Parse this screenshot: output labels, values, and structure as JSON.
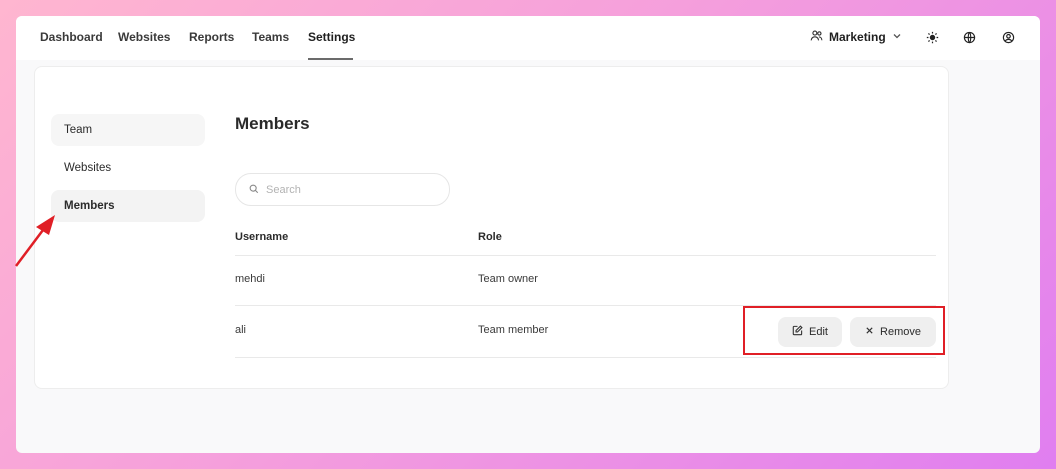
{
  "nav": {
    "items": [
      "Dashboard",
      "Websites",
      "Reports",
      "Teams",
      "Settings"
    ],
    "active": "Settings",
    "team_selector": "Marketing"
  },
  "sidebar": {
    "items": [
      {
        "label": "Team"
      },
      {
        "label": "Websites"
      },
      {
        "label": "Members",
        "active": true
      }
    ]
  },
  "main": {
    "title": "Members",
    "search_placeholder": "Search",
    "table": {
      "columns": [
        "Username",
        "Role"
      ],
      "rows": [
        {
          "username": "mehdi",
          "role": "Team owner"
        },
        {
          "username": "ali",
          "role": "Team member",
          "actions": [
            "Edit",
            "Remove"
          ]
        }
      ]
    }
  },
  "colors": {
    "annotation": "#e01f26",
    "background_gradient": [
      "#ffb6d0",
      "#e07ef0"
    ]
  },
  "icons": [
    "team-icon",
    "chevron-down-icon",
    "sun-icon",
    "globe-icon",
    "user-circle-icon",
    "search-icon",
    "edit-icon",
    "close-icon"
  ]
}
